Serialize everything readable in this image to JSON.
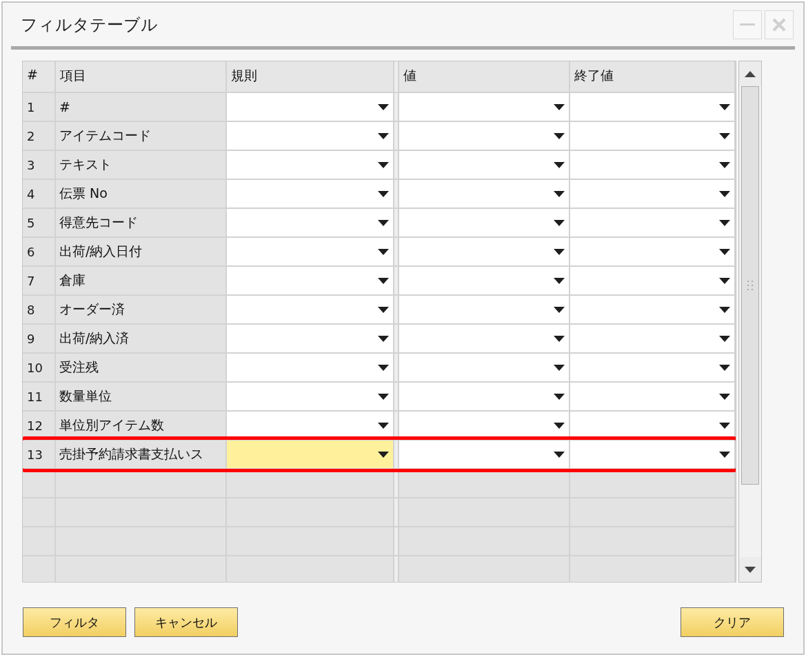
{
  "window": {
    "title": "フィルタテーブル"
  },
  "columns": [
    "#",
    "項目",
    "規則",
    "値",
    "終了値"
  ],
  "rows": [
    {
      "number": "1",
      "item": "#",
      "active": false,
      "highlighted": false
    },
    {
      "number": "2",
      "item": "アイテムコード",
      "active": false,
      "highlighted": false
    },
    {
      "number": "3",
      "item": "テキスト",
      "active": false,
      "highlighted": false
    },
    {
      "number": "4",
      "item": "伝票 No",
      "active": false,
      "highlighted": false
    },
    {
      "number": "5",
      "item": "得意先コード",
      "active": false,
      "highlighted": false
    },
    {
      "number": "6",
      "item": "出荷/納入日付",
      "active": false,
      "highlighted": false
    },
    {
      "number": "7",
      "item": "倉庫",
      "active": false,
      "highlighted": false
    },
    {
      "number": "8",
      "item": "オーダー済",
      "active": false,
      "highlighted": false
    },
    {
      "number": "9",
      "item": "出荷/納入済",
      "active": false,
      "highlighted": false
    },
    {
      "number": "10",
      "item": "受注残",
      "active": false,
      "highlighted": false
    },
    {
      "number": "11",
      "item": "数量単位",
      "active": false,
      "highlighted": false
    },
    {
      "number": "12",
      "item": "単位別アイテム数",
      "active": false,
      "highlighted": false
    },
    {
      "number": "13",
      "item": "売掛予約請求書支払いス",
      "active": true,
      "highlighted": true
    }
  ],
  "buttons": [
    "フィルタ",
    "キャンセル"
  ],
  "right_buttons": [
    "クリア"
  ]
}
